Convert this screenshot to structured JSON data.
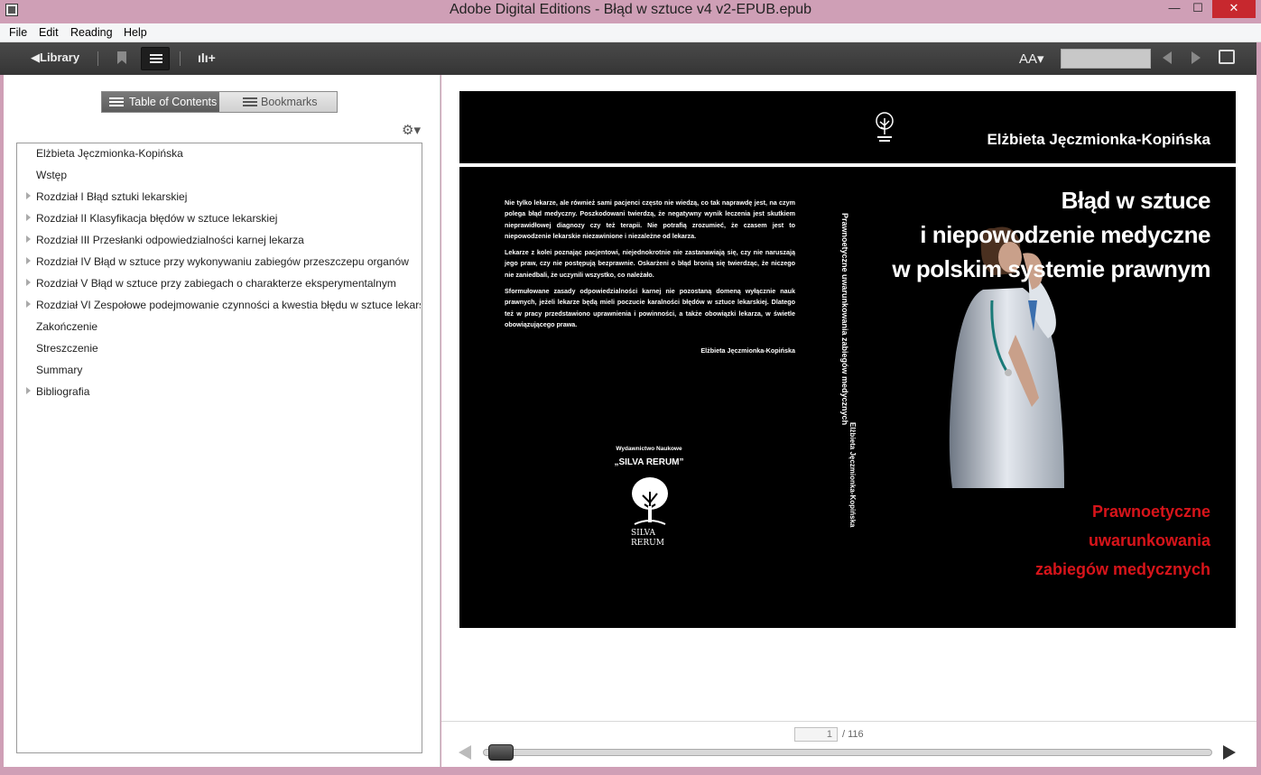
{
  "window": {
    "title": "Adobe Digital Editions - Błąd w sztuce v4 v2-EPUB.epub",
    "minimize": "—",
    "maximize": "☐",
    "close": "✕"
  },
  "menu": [
    "File",
    "Edit",
    "Reading",
    "Help"
  ],
  "toolbar": {
    "library_label": "◀Library",
    "font_size_label": "AA▾",
    "search_value": ""
  },
  "tabs": {
    "toc_label": "Table of Contents",
    "bookmarks_label": "Bookmarks"
  },
  "toc": [
    {
      "label": "Elżbieta Jęczmionka-Kopińska",
      "expandable": false
    },
    {
      "label": "Wstęp",
      "expandable": false
    },
    {
      "label": "Rozdział I Błąd sztuki lekarskiej",
      "expandable": true
    },
    {
      "label": "Rozdział II Klasyfikacja błędów w sztuce lekarskiej",
      "expandable": true
    },
    {
      "label": "Rozdział III Przesłanki odpowiedzialności karnej lekarza",
      "expandable": true
    },
    {
      "label": "Rozdział IV Błąd w sztuce przy wykonywaniu zabiegów przeszczepu organów",
      "expandable": true
    },
    {
      "label": "Rozdział V Błąd w sztuce przy zabiegach o charakterze eksperymentalnym",
      "expandable": true
    },
    {
      "label": "Rozdział VI Zespołowe podejmowanie czynności a kwestia błędu w sztuce lekarskiej",
      "expandable": true
    },
    {
      "label": "Zakończenie",
      "expandable": false
    },
    {
      "label": "Streszczenie",
      "expandable": false
    },
    {
      "label": "Summary",
      "expandable": false
    },
    {
      "label": "Bibliografia",
      "expandable": true
    }
  ],
  "cover": {
    "author": "Elżbieta Jęczmionka-Kopińska",
    "title_lines": [
      "Błąd w sztuce",
      "i niepowodzenie medyczne",
      "w polskim systemie prawnym"
    ],
    "subtitle_lines": [
      "Prawnoetyczne",
      "uwarunkowania",
      "zabiegów medycznych"
    ],
    "back_paragraphs": [
      "Nie tylko lekarze, ale również sami pacjenci często nie wiedzą, co tak naprawdę jest, na czym polega błąd medyczny. Poszkodowani twierdzą, że negatywny wynik leczenia jest skutkiem nieprawidłowej diagnozy czy też terapii. Nie potrafią zrozumieć, że czasem jest to niepowodzenie lekarskie niezawinione i niezależne od lekarza.",
      "Lekarze z kolei poznając pacjentowi, niejednokrotnie nie zastanawiają się, czy nie naruszają jego praw, czy nie postępują bezprawnie. Oskarżeni o błąd bronią się twierdząc, że niczego nie zaniedbali, że uczynili wszystko, co należało.",
      "Sformułowane zasady odpowiedzialności karnej nie pozostaną domeną wyłącznie nauk prawnych, jeżeli lekarze będą mieli poczucie karalności błędów w sztuce lekarskiej. Dlatego też w pracy przedstawiono uprawnienia i powinności, a także obowiązki lekarza, w świetle obowiązującego prawa."
    ],
    "back_signature": "Elżbieta Jęczmionka-Kopińska",
    "publisher_line1": "Wydawnictwo Naukowe",
    "publisher_line2": "„SILVA RERUM”",
    "logo_text_1": "SILVA",
    "logo_text_2": "RERUM",
    "spine_title": "Prawnoetyczne uwarunkowania zabiegów medycznych",
    "spine_author": "Elżbieta Jęczmionka-Kopińska"
  },
  "pagination": {
    "current_page": "1",
    "total_label": "/ 116",
    "progress": 0.0
  }
}
